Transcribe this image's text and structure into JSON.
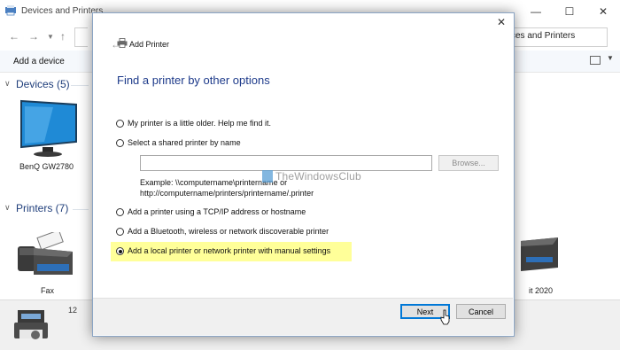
{
  "window": {
    "title": "Devices and Printers",
    "address_text": "ces and Printers",
    "add_device_label": "Add a device"
  },
  "groups": {
    "devices_header": "Devices (5)",
    "printers_header": "Printers (7)"
  },
  "device_items": {
    "monitor_label": "BenQ GW2780",
    "fax_label": "Fax",
    "right_partial_label": "it 2020"
  },
  "status": {
    "count": "12"
  },
  "dialog": {
    "title": "Add Printer",
    "heading": "Find a printer by other options",
    "options": [
      {
        "label": "My printer is a little older. Help me find it.",
        "checked": false
      },
      {
        "label": "Select a shared printer by name",
        "checked": false
      },
      {
        "label": "Add a printer using a TCP/IP address or hostname",
        "checked": false
      },
      {
        "label": "Add a Bluetooth, wireless or network discoverable printer",
        "checked": false
      },
      {
        "label": "Add a local printer or network printer with manual settings",
        "checked": true
      }
    ],
    "shared_printer_value": "",
    "browse_label": "Browse...",
    "example_line1": "Example: \\\\computername\\printername or",
    "example_line2": "http://computername/printers/printername/.printer",
    "next_label": "Next",
    "cancel_label": "Cancel"
  },
  "watermark": {
    "text": "TheWindowsClub"
  },
  "colors": {
    "heading": "#1d3a8a",
    "highlight": "#ffff99",
    "accent": "#0078d7",
    "group_header": "#1e3d7a"
  },
  "icons": [
    "back-arrow-icon",
    "printer-icon",
    "close-icon",
    "monitor-icon",
    "fax-icon",
    "printer-device-icon",
    "folder-icon",
    "cursor-icon"
  ]
}
